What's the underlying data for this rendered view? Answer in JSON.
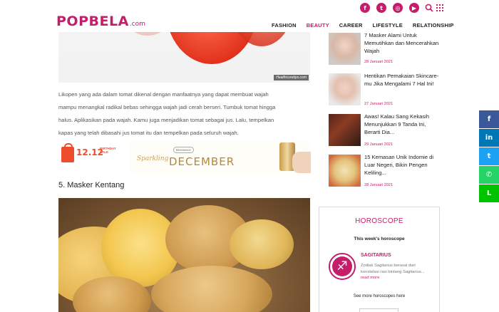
{
  "header": {
    "logo_main": "POPBELA",
    "logo_suffix": ".com",
    "social": [
      {
        "icon": "facebook-icon",
        "glyph": "f"
      },
      {
        "icon": "twitter-icon",
        "glyph": "t"
      },
      {
        "icon": "instagram-icon",
        "glyph": "◎"
      },
      {
        "icon": "youtube-icon",
        "glyph": "▶"
      }
    ],
    "nav": [
      {
        "label": "FASHION",
        "active": false
      },
      {
        "label": "BEAUTY",
        "active": true
      },
      {
        "label": "CAREER",
        "active": false
      },
      {
        "label": "LIFESTYLE",
        "active": false
      },
      {
        "label": "RELATIONSHIP",
        "active": false
      }
    ]
  },
  "article": {
    "image_credit": "Healthcuretips.com",
    "paragraph": [
      "Likopen yang ada dalam tomat dikenal dengan manfaatnya yang dapat membuat wajah",
      "mampu menangkal radikal bebas sehingga wajah jadi cerah berseri. Tumbuk tomat hingga",
      "halus. Aplikasikan pada wajah. Kamu juga menjadikan tomat sebagai jus. Lalu, tempelkan",
      "kapas yang telah dibasahi jus tomat itu dan tempelkan pada seluruh wajah."
    ],
    "ad": {
      "sale_number": "12.12",
      "sale_text": "BIRTHDAY SALE",
      "brand": "Biossance",
      "sparkling": "Sparkling",
      "december": "DECEMBER"
    },
    "section_title": "5. Masker Kentang"
  },
  "sidebar": {
    "items": [
      {
        "title": "7 Masker Alami Untuk Memutihkan dan Mencerahkan Wajah",
        "date": "28 Januari 2021"
      },
      {
        "title": "Hentikan Pemakaian Skincare-mu Jika Mengalami 7 Hal Ini!",
        "date": "27 Januari 2021"
      },
      {
        "title": "Awas! Kalau Sang Kekasih Menunjukkan 9 Tanda Ini, Berarti Dia...",
        "date": "29 Januari 2021"
      },
      {
        "title": "15 Kemasan Unik Indomie di Luar Negeri, Bikin Pengen Keliling...",
        "date": "28 Januari 2021"
      }
    ],
    "horoscope": {
      "title": "HOROSCOPE",
      "subtitle": "This week's horoscope",
      "sign_name": "SAGITARIUS",
      "sign_glyph": "♐",
      "sign_desc": "Zodiak Sagitarius berasal dari konstelasi rasi bintang Sagitarius...",
      "read_more": "read more",
      "see_more": "See more horoscopes here"
    }
  },
  "share": [
    {
      "icon": "facebook-icon",
      "glyph": "f",
      "color": "#3b5998"
    },
    {
      "icon": "linkedin-icon",
      "glyph": "in",
      "color": "#0077b5"
    },
    {
      "icon": "twitter-icon",
      "glyph": "t",
      "color": "#1da1f2"
    },
    {
      "icon": "whatsapp-icon",
      "glyph": "✆",
      "color": "#25d366"
    },
    {
      "icon": "line-icon",
      "glyph": "L",
      "color": "#00c300"
    }
  ],
  "colors": {
    "brand": "#c41e6b"
  }
}
